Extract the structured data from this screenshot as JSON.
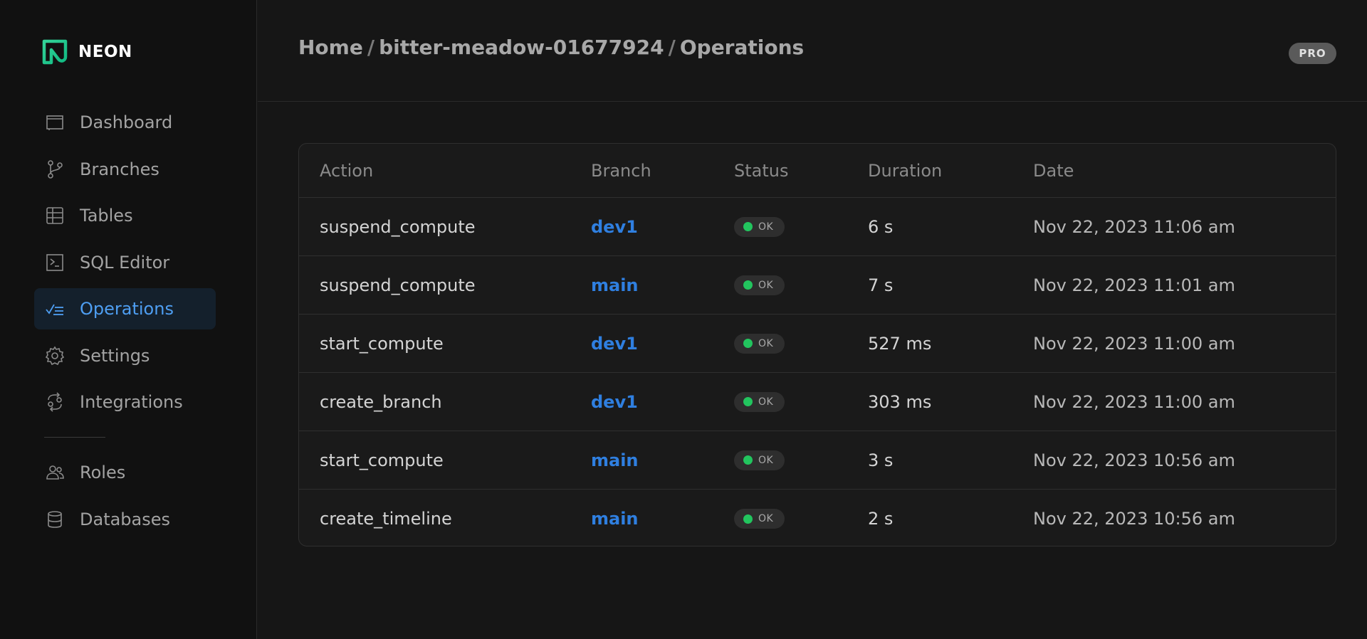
{
  "brand": {
    "name": "NEON",
    "accent": "#34d399"
  },
  "sidebar": {
    "items": [
      {
        "label": "Dashboard",
        "icon": "dashboard-icon"
      },
      {
        "label": "Branches",
        "icon": "branch-icon"
      },
      {
        "label": "Tables",
        "icon": "table-icon"
      },
      {
        "label": "SQL Editor",
        "icon": "terminal-icon"
      },
      {
        "label": "Operations",
        "icon": "operations-icon",
        "active": true
      },
      {
        "label": "Settings",
        "icon": "gear-icon"
      },
      {
        "label": "Integrations",
        "icon": "integrations-icon"
      }
    ],
    "secondary_items": [
      {
        "label": "Roles",
        "icon": "users-icon"
      },
      {
        "label": "Databases",
        "icon": "database-icon"
      }
    ]
  },
  "header": {
    "breadcrumb": [
      "Home",
      "bitter-meadow-01677924",
      "Operations"
    ],
    "separator": "/",
    "plan_badge": "PRO"
  },
  "table": {
    "columns": [
      "Action",
      "Branch",
      "Status",
      "Duration",
      "Date"
    ],
    "rows": [
      {
        "action": "suspend_compute",
        "branch": "dev1",
        "status": "OK",
        "duration": "6 s",
        "date": "Nov 22, 2023 11:06 am"
      },
      {
        "action": "suspend_compute",
        "branch": "main",
        "status": "OK",
        "duration": "7 s",
        "date": "Nov 22, 2023 11:01 am"
      },
      {
        "action": "start_compute",
        "branch": "dev1",
        "status": "OK",
        "duration": "527 ms",
        "date": "Nov 22, 2023 11:00 am"
      },
      {
        "action": "create_branch",
        "branch": "dev1",
        "status": "OK",
        "duration": "303 ms",
        "date": "Nov 22, 2023 11:00 am"
      },
      {
        "action": "start_compute",
        "branch": "main",
        "status": "OK",
        "duration": "3 s",
        "date": "Nov 22, 2023 10:56 am"
      },
      {
        "action": "create_timeline",
        "branch": "main",
        "status": "OK",
        "duration": "2 s",
        "date": "Nov 22, 2023 10:56 am"
      }
    ]
  },
  "colors": {
    "status_ok": "#22c55e",
    "link": "#2f7fe0",
    "active_nav": "#4e9ef2"
  }
}
